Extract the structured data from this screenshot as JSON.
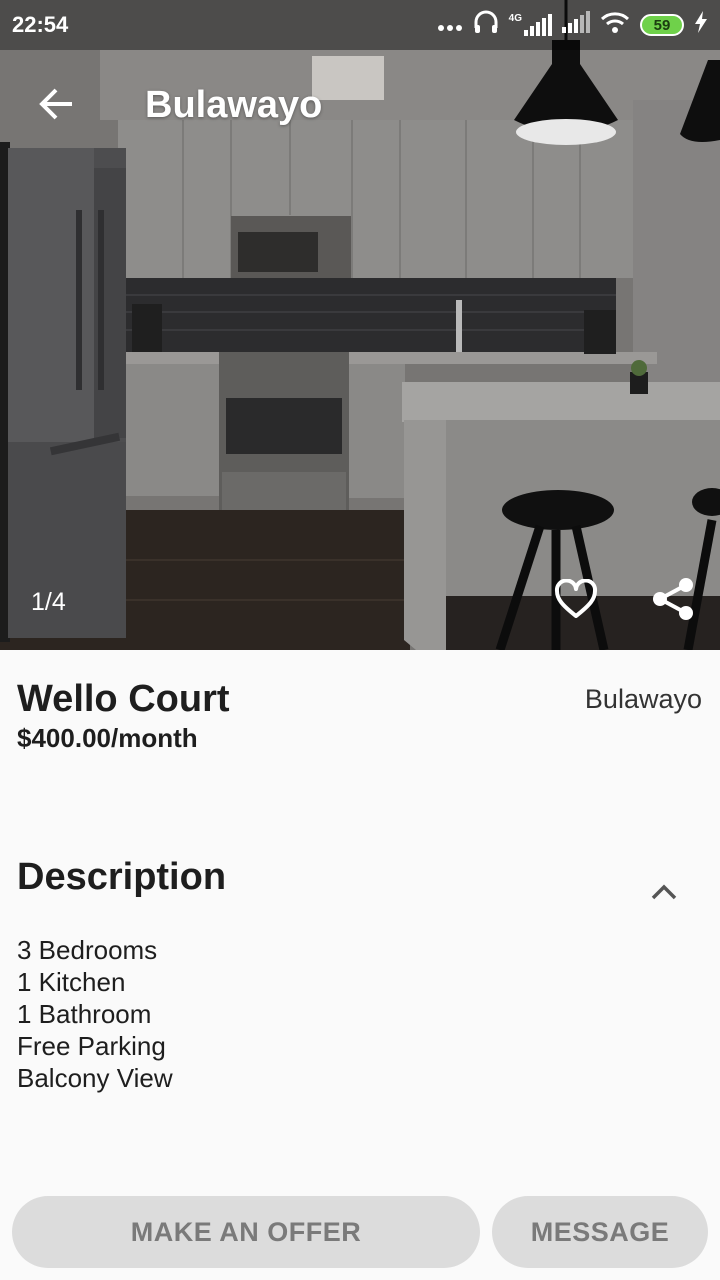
{
  "status_bar": {
    "time": "22:54",
    "network_label": "4G",
    "battery": "59"
  },
  "app_bar": {
    "title": "Bulawayo",
    "back_icon": "arrow-back-icon"
  },
  "gallery": {
    "indicator": "1/4",
    "favorite_icon": "heart-outline-icon",
    "share_icon": "share-icon"
  },
  "listing": {
    "name": "Wello Court",
    "price": "$400.00/month",
    "location": "Bulawayo"
  },
  "description": {
    "heading": "Description",
    "collapse_icon": "chevron-up-icon",
    "items": [
      "3 Bedrooms",
      "1 Kitchen",
      "1 Bathroom",
      "Free Parking",
      "Balcony View"
    ]
  },
  "actions": {
    "offer_label": "MAKE AN OFFER",
    "message_label": "MESSAGE"
  },
  "colors": {
    "button_bg": "#dcdcdc",
    "button_text": "#7a7a7a",
    "battery": "#6fd14a"
  }
}
